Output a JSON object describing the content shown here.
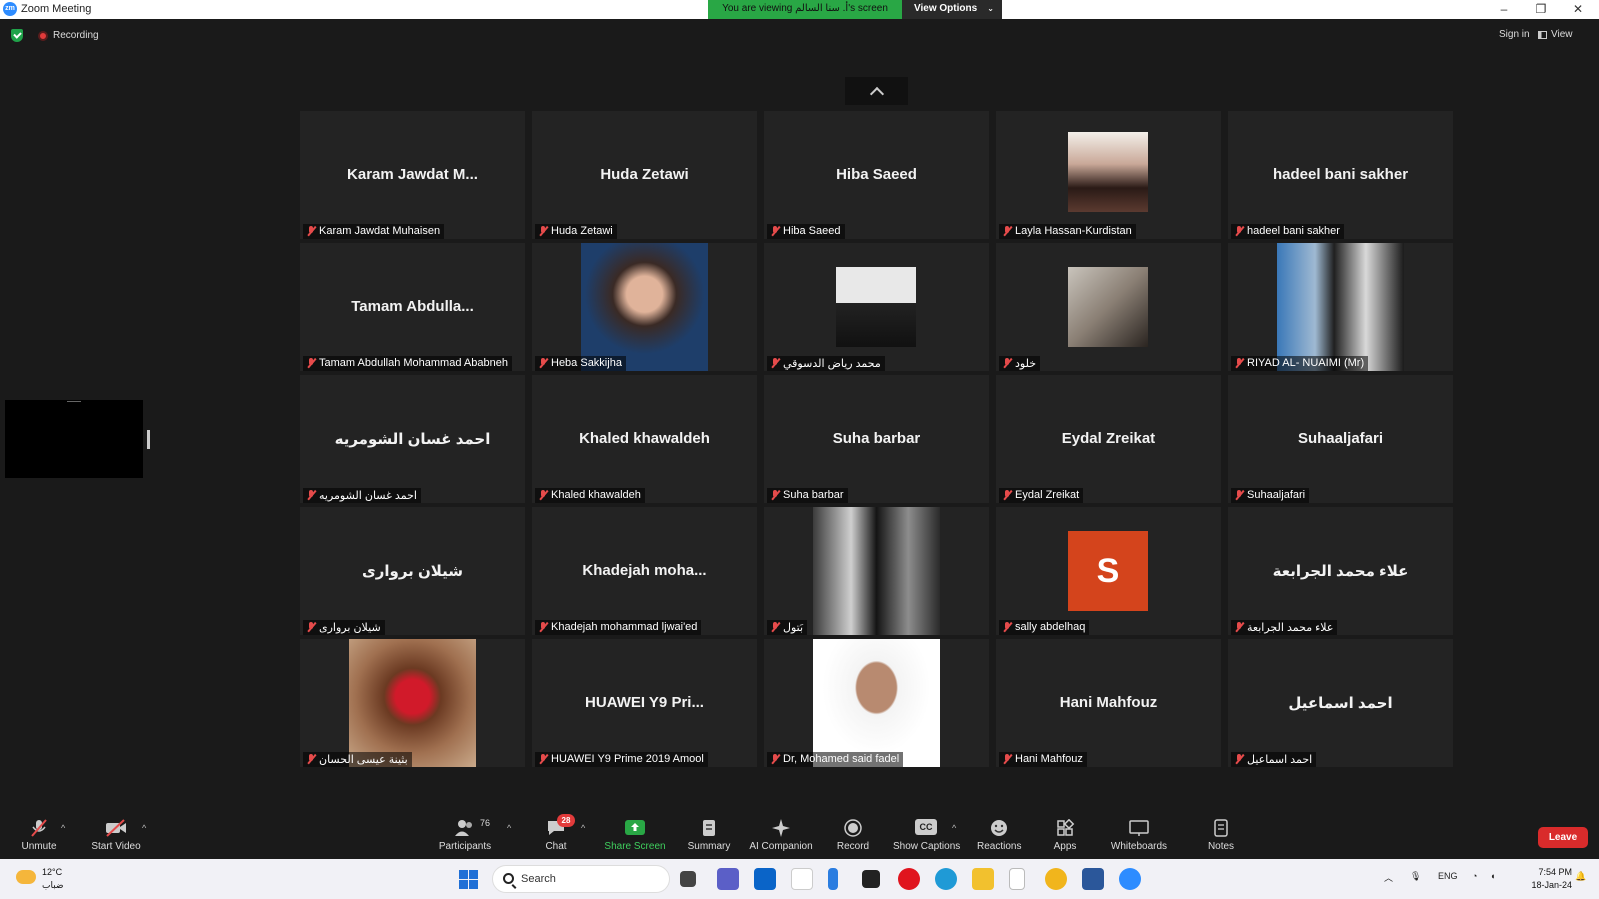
{
  "window": {
    "app_icon": "zm",
    "title": "Zoom Meeting",
    "share_banner": "You are viewing أ. سنا السالم's screen",
    "view_options_label": "View Options",
    "controls": [
      "–",
      "❐",
      "✕"
    ]
  },
  "meeting_bar": {
    "recording_label": "Recording",
    "sign_in_label": "Sign in",
    "view_label": "View"
  },
  "tiles": [
    {
      "display": "Karam Jawdat M...",
      "label": "Karam Jawdat Muhaisen"
    },
    {
      "display": "Huda Zetawi",
      "label": "Huda Zetawi"
    },
    {
      "display": "Hiba Saeed",
      "label": "Hiba Saeed"
    },
    {
      "display": "",
      "label": "Layla Hassan-Kurdistan",
      "photo": "portrait-woman"
    },
    {
      "display": "hadeel bani sakher",
      "label": "hadeel bani sakher"
    },
    {
      "display": "Tamam  Abdulla...",
      "label": "Tamam Abdullah Mohammad Ababneh"
    },
    {
      "display": "",
      "label": "Heba Sakkijha",
      "photo": "portrait-woman-blue"
    },
    {
      "display": "",
      "label": "محمد رياض الدسوقي",
      "photo": "portrait-man-suit"
    },
    {
      "display": "",
      "label": "خلود",
      "photo": "mirror-selfie"
    },
    {
      "display": "",
      "label": "RIYAD AL- NUAIMI (Mr)",
      "photo": "two-men-banner"
    },
    {
      "display": "احمد غسان الشومريه",
      "label": "احمد غسان الشومريه"
    },
    {
      "display": "Khaled khawaldeh",
      "label": "Khaled khawaldeh"
    },
    {
      "display": "Suha barbar",
      "label": "Suha barbar"
    },
    {
      "display": "Eydal Zreikat",
      "label": "Eydal Zreikat"
    },
    {
      "display": "Suhaaljafari",
      "label": "Suhaaljafari"
    },
    {
      "display": "شيلان بروارى",
      "label": "شيلان بروارى"
    },
    {
      "display": "Khadejah  moha...",
      "label": "Khadejah mohammad ljwai'ed"
    },
    {
      "display": "",
      "label": "بَتول",
      "photo": "woman-black-dress"
    },
    {
      "display": "",
      "label": "sally abdelhaq",
      "avatar_letter": "S"
    },
    {
      "display": "علاء محمد الجرابعة",
      "label": "علاء محمد الجرابعة"
    },
    {
      "display": "",
      "label": "بثينة عيسى الحسان",
      "photo": "strawberry-chocolate"
    },
    {
      "display": "HUAWEI Y9 Pri...",
      "label": "HUAWEI Y9 Prime 2019 Amool"
    },
    {
      "display": "",
      "label": "Dr, Mohamed said fadel",
      "photo": "portrait-man-passport"
    },
    {
      "display": "Hani Mahfouz",
      "label": "Hani Mahfouz"
    },
    {
      "display": "احمد اسماعيل",
      "label": "احمد اسماعيل"
    }
  ],
  "toolbar": {
    "unmute": "Unmute",
    "start_video": "Start Video",
    "participants": "Participants",
    "participants_count": "76",
    "chat": "Chat",
    "chat_badge": "28",
    "share_screen": "Share Screen",
    "summary": "Summary",
    "ai_companion": "AI Companion",
    "record": "Record",
    "show_captions": "Show Captions",
    "captions_icon": "CC",
    "reactions": "Reactions",
    "apps": "Apps",
    "whiteboards": "Whiteboards",
    "notes": "Notes",
    "leave": "Leave"
  },
  "taskbar": {
    "weather_temp": "12°C",
    "weather_desc": "ضباب",
    "search_placeholder": "Search",
    "language": "ENG",
    "time": "7:54 PM",
    "date": "18-Jan-24"
  },
  "colors": {
    "accent_green": "#29a745",
    "leave_red": "#d92b2b",
    "zoom_blue": "#2d8cff",
    "avatar_orange": "#d4441c"
  }
}
